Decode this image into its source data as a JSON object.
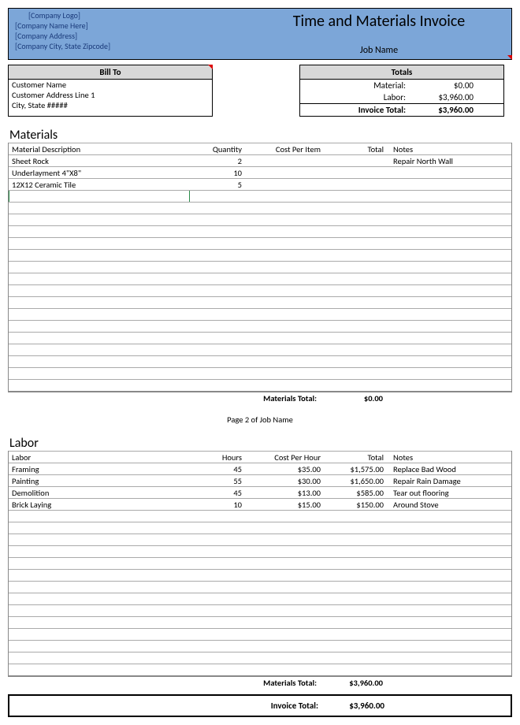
{
  "header": {
    "logo_placeholder": "[Company Logo]",
    "company_name": "[Company Name Here]",
    "company_address": "[Company Address]",
    "company_csz": "[Company City, State Zipcode]",
    "title": "Time and Materials Invoice",
    "job_name": "Job Name"
  },
  "bill_to": {
    "heading": "Bill To",
    "name": "Customer Name",
    "addr1": "Customer Address Line 1",
    "csz": "City, State #####"
  },
  "totals": {
    "heading": "Totals",
    "material_label": "Material:",
    "material_value": "$0.00",
    "labor_label": "Labor:",
    "labor_value": "$3,960.00",
    "invoice_label": "Invoice Total:",
    "invoice_value": "$3,960.00"
  },
  "materials": {
    "title": "Materials",
    "columns": {
      "desc": "Material Description",
      "qty": "Quantity",
      "cost": "Cost Per Item",
      "total": "Total",
      "notes": "Notes"
    },
    "rows": [
      {
        "desc": "Sheet Rock",
        "qty": "2",
        "cost": "",
        "total": "",
        "notes": "Repair North Wall"
      },
      {
        "desc": "Underlayment 4\"X8\"",
        "qty": "10",
        "cost": "",
        "total": "",
        "notes": ""
      },
      {
        "desc": "12X12 Ceramic Tile",
        "qty": "5",
        "cost": "",
        "total": "",
        "notes": ""
      }
    ],
    "empty_rows": 17,
    "total_label": "Materials Total:",
    "total_value": "$0.00"
  },
  "page_divider": "Page 2 of Job Name",
  "labor": {
    "title": "Labor",
    "columns": {
      "desc": "Labor",
      "qty": "Hours",
      "cost": "Cost Per Hour",
      "total": "Total",
      "notes": "Notes"
    },
    "rows": [
      {
        "desc": "Framing",
        "qty": "45",
        "cost": "$35.00",
        "total": "$1,575.00",
        "notes": "Replace Bad Wood"
      },
      {
        "desc": "Painting",
        "qty": "55",
        "cost": "$30.00",
        "total": "$1,650.00",
        "notes": "Repair Rain Damage"
      },
      {
        "desc": "Demolition",
        "qty": "45",
        "cost": "$13.00",
        "total": "$585.00",
        "notes": "Tear out flooring"
      },
      {
        "desc": "Brick Laying",
        "qty": "10",
        "cost": "$15.00",
        "total": "$150.00",
        "notes": "Around Stove"
      }
    ],
    "empty_rows": 14,
    "total_label": "Materials Total:",
    "total_value": "$3,960.00"
  },
  "invoice_total": {
    "label": "Invoice Total:",
    "value": "$3,960.00"
  }
}
